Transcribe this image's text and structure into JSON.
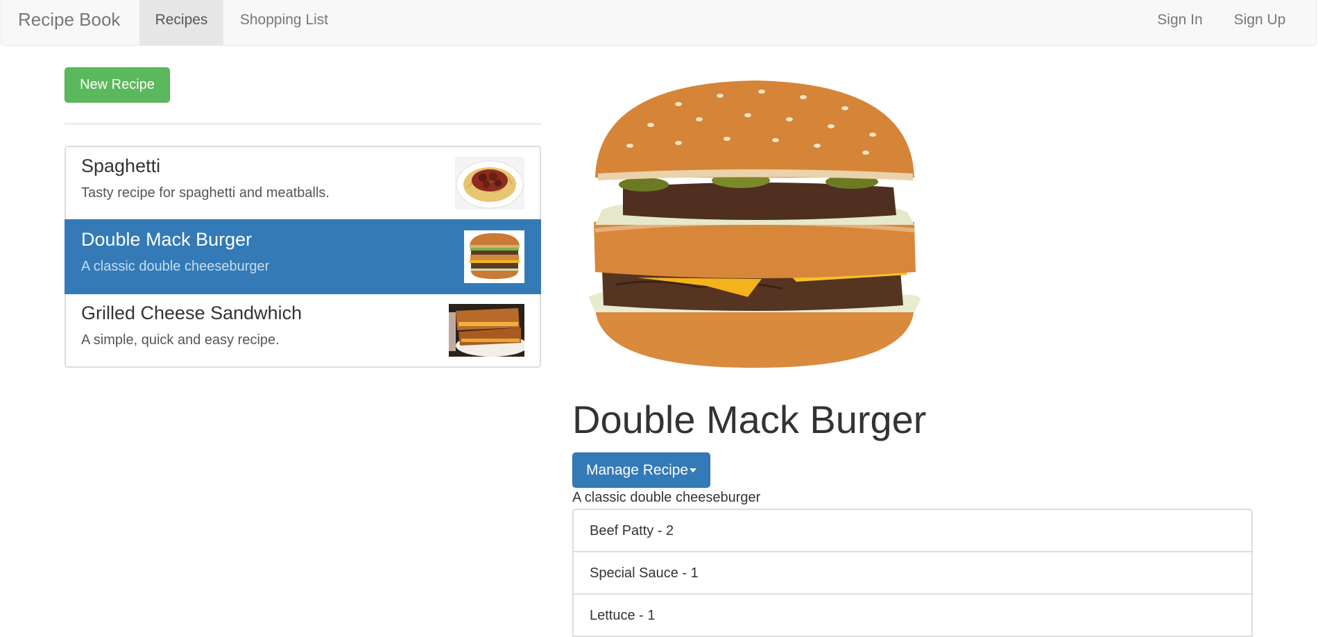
{
  "navbar": {
    "brand": "Recipe Book",
    "links": {
      "recipes": "Recipes",
      "shopping_list": "Shopping List"
    },
    "auth": {
      "sign_in": "Sign In",
      "sign_up": "Sign Up"
    },
    "active": "Recipes"
  },
  "sidebar": {
    "new_recipe_label": "New Recipe",
    "recipes": [
      {
        "name": "Spaghetti",
        "description": "Tasty recipe for spaghetti and meatballs.",
        "thumbnail": "spaghetti-image",
        "active": false
      },
      {
        "name": "Double Mack Burger",
        "description": "A classic double cheeseburger",
        "thumbnail": "burger-image",
        "active": true
      },
      {
        "name": "Grilled Cheese Sandwhich",
        "description": "A simple, quick and easy recipe.",
        "thumbnail": "grilled-cheese-image",
        "active": false
      }
    ]
  },
  "detail": {
    "image": "burger-image",
    "title": "Double Mack Burger",
    "manage_label": "Manage Recipe",
    "description": "A classic double cheeseburger",
    "ingredients": [
      "Beef Patty - 2",
      "Special Sauce - 1",
      "Lettuce - 1"
    ]
  },
  "colors": {
    "primary": "#337ab7",
    "success": "#5cb85c",
    "navbar_bg": "#f8f8f8"
  }
}
